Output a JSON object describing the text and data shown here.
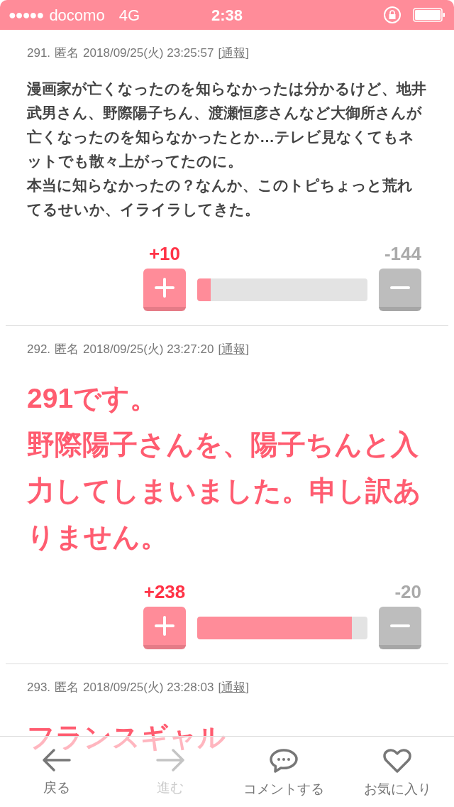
{
  "status_bar": {
    "signal_dots": "●●●●●",
    "carrier": "docomo",
    "network": "4G",
    "time": "2:38"
  },
  "comments": [
    {
      "number": "291.",
      "author": "匿名",
      "date": "2018/09/25(火) 23:25:57",
      "report": {
        "open": "[",
        "label": "通報",
        "close": "]"
      },
      "kind": "normal",
      "paragraphs": [
        "漫画家が亡くなったのを知らなかったは分かるけど、地井武男さん、野際陽子ちん、渡瀬恒彦さんなど大御所さんが亡くなったのを知らなかったとか…テレビ見なくてもネットでも散々上がってたのに。",
        "本当に知らなかったの？なんか、このトピちょっと荒れてるせいか、イライラしてきた。"
      ],
      "plus": "+10",
      "minus": "-144",
      "level": 0.08
    },
    {
      "number": "292.",
      "author": "匿名",
      "date": "2018/09/25(火) 23:27:20",
      "report": {
        "open": "[",
        "label": "通報",
        "close": "]"
      },
      "kind": "large",
      "paragraphs": [
        "291です。",
        "野際陽子さんを、陽子ちんと入力してしまいました。申し訳ありません。"
      ],
      "plus": "+238",
      "minus": "-20",
      "level": 0.91
    },
    {
      "number": "293.",
      "author": "匿名",
      "date": "2018/09/25(火) 23:28:03",
      "report": {
        "open": "[",
        "label": "通報",
        "close": "]"
      },
      "kind": "large",
      "paragraphs": [
        "フランスギャル"
      ]
    }
  ],
  "bottom_nav": [
    {
      "kind": "back",
      "label": "戻る",
      "disabled": false
    },
    {
      "kind": "forward",
      "label": "進む",
      "disabled": true
    },
    {
      "kind": "comment",
      "label": "コメントする",
      "disabled": false
    },
    {
      "kind": "favorite",
      "label": "お気に入り",
      "disabled": false
    }
  ]
}
